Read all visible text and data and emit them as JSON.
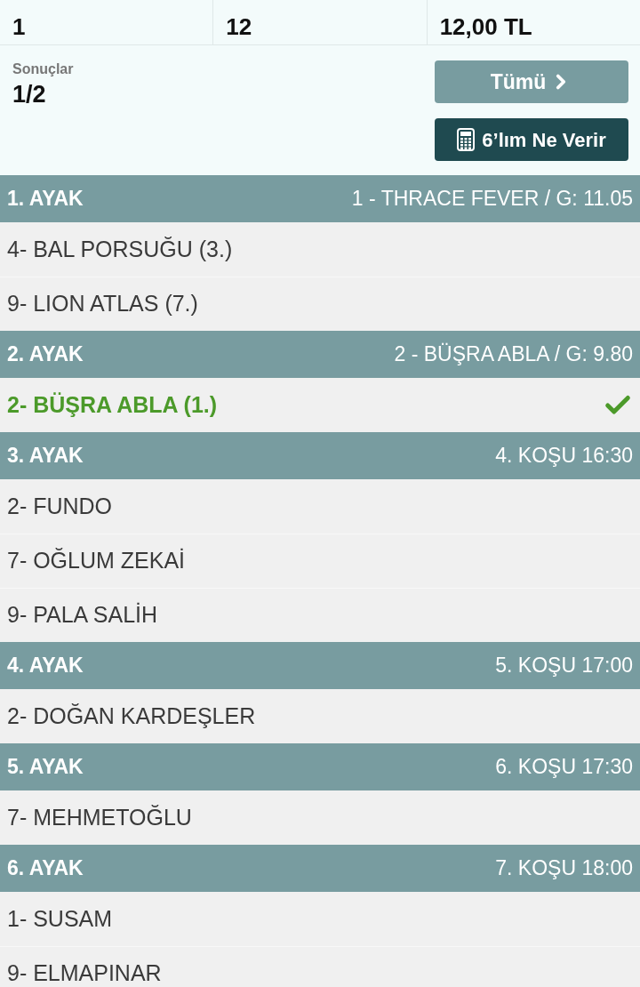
{
  "summary": [
    {
      "value": "1"
    },
    {
      "value": "12"
    },
    {
      "value": "12,00 TL"
    }
  ],
  "results": {
    "label": "Sonuçlar",
    "value": "1/2"
  },
  "buttons": [
    {
      "kind": "all",
      "label": "Tümü"
    },
    {
      "kind": "calculator",
      "label": "6’lım Ne Verir"
    }
  ],
  "legs": [
    {
      "title": "1. AYAK",
      "info": "1 - THRACE FEVER / G: 11.05",
      "picks": [
        {
          "label": "4- BAL PORSUĞU (3.)",
          "won": false
        },
        {
          "label": "9- LION ATLAS (7.)",
          "won": false
        }
      ]
    },
    {
      "title": "2. AYAK",
      "info": "2 - BÜŞRA ABLA / G: 9.80",
      "picks": [
        {
          "label": "2- BÜŞRA ABLA (1.)",
          "won": true
        }
      ]
    },
    {
      "title": "3. AYAK",
      "info": "4. KOŞU 16:30",
      "picks": [
        {
          "label": "2- FUNDO",
          "won": false
        },
        {
          "label": "7- OĞLUM ZEKAİ",
          "won": false
        },
        {
          "label": "9- PALA SALİH",
          "won": false
        }
      ]
    },
    {
      "title": "4. AYAK",
      "info": "5. KOŞU 17:00",
      "picks": [
        {
          "label": "2- DOĞAN KARDEŞLER",
          "won": false
        }
      ]
    },
    {
      "title": "5. AYAK",
      "info": "6. KOŞU 17:30",
      "picks": [
        {
          "label": "7- MEHMETOĞLU",
          "won": false
        }
      ]
    },
    {
      "title": "6. AYAK",
      "info": "7. KOŞU 18:00",
      "picks": [
        {
          "label": "1- SUSAM",
          "won": false
        },
        {
          "label": "9- ELMAPINAR",
          "won": false
        }
      ]
    }
  ]
}
